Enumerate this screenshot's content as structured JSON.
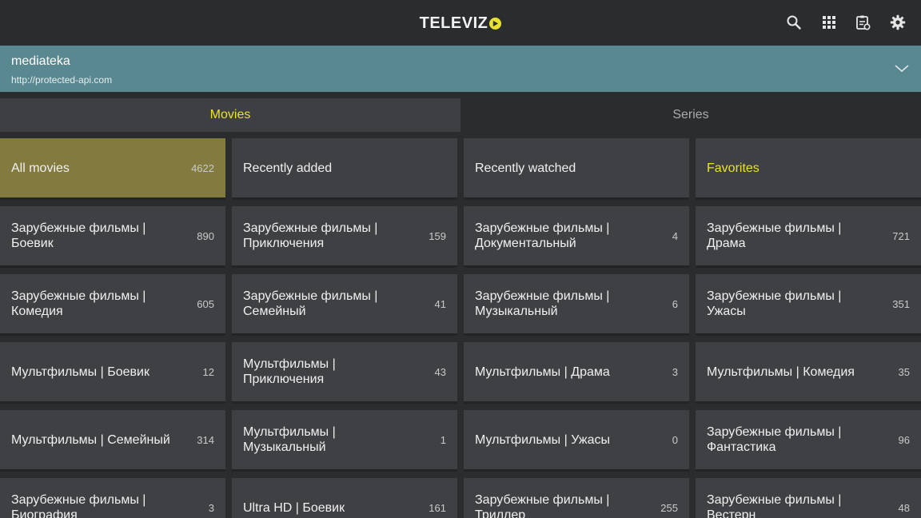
{
  "app": {
    "logo_text": "TELEVIZ"
  },
  "topbar": {
    "icons": [
      "search-icon",
      "apps-grid-icon",
      "playlist-icon",
      "gear-icon"
    ]
  },
  "source": {
    "name": "mediateka",
    "url": "http://protected-api.com"
  },
  "tabs": [
    {
      "label": "Movies",
      "active": true
    },
    {
      "label": "Series",
      "active": false
    }
  ],
  "colors": {
    "accent": "#e8e22a",
    "selected_tile": "#827a3f",
    "source_bar": "#5a8890",
    "tile": "#3f4043",
    "background": "#2b2c2e"
  },
  "categories": [
    {
      "label": "All movies",
      "count": "4622"
    },
    {
      "label": "Recently added",
      "count": ""
    },
    {
      "label": "Recently watched",
      "count": ""
    },
    {
      "label": "Favorites",
      "count": ""
    },
    {
      "label": "Зарубежные фильмы | Боевик",
      "count": "890"
    },
    {
      "label": "Зарубежные фильмы | Приключения",
      "count": "159"
    },
    {
      "label": "Зарубежные фильмы | Документальный",
      "count": "4"
    },
    {
      "label": "Зарубежные фильмы | Драма",
      "count": "721"
    },
    {
      "label": "Зарубежные фильмы | Комедия",
      "count": "605"
    },
    {
      "label": "Зарубежные фильмы | Семейный",
      "count": "41"
    },
    {
      "label": "Зарубежные фильмы | Музыкальный",
      "count": "6"
    },
    {
      "label": "Зарубежные фильмы | Ужасы",
      "count": "351"
    },
    {
      "label": "Мультфильмы | Боевик",
      "count": "12"
    },
    {
      "label": "Мультфильмы | Приключения",
      "count": "43"
    },
    {
      "label": "Мультфильмы | Драма",
      "count": "3"
    },
    {
      "label": "Мультфильмы | Комедия",
      "count": "35"
    },
    {
      "label": "Мультфильмы | Семейный",
      "count": "314"
    },
    {
      "label": "Мультфильмы | Музыкальный",
      "count": "1"
    },
    {
      "label": "Мультфильмы | Ужасы",
      "count": "0"
    },
    {
      "label": "Зарубежные фильмы | Фантастика",
      "count": "96"
    },
    {
      "label": "Зарубежные фильмы | Биография",
      "count": "3"
    },
    {
      "label": "Ultra HD | Боевик",
      "count": "161"
    },
    {
      "label": "Зарубежные фильмы | Триллер",
      "count": "255"
    },
    {
      "label": "Зарубежные фильмы | Вестерн",
      "count": "48"
    }
  ]
}
